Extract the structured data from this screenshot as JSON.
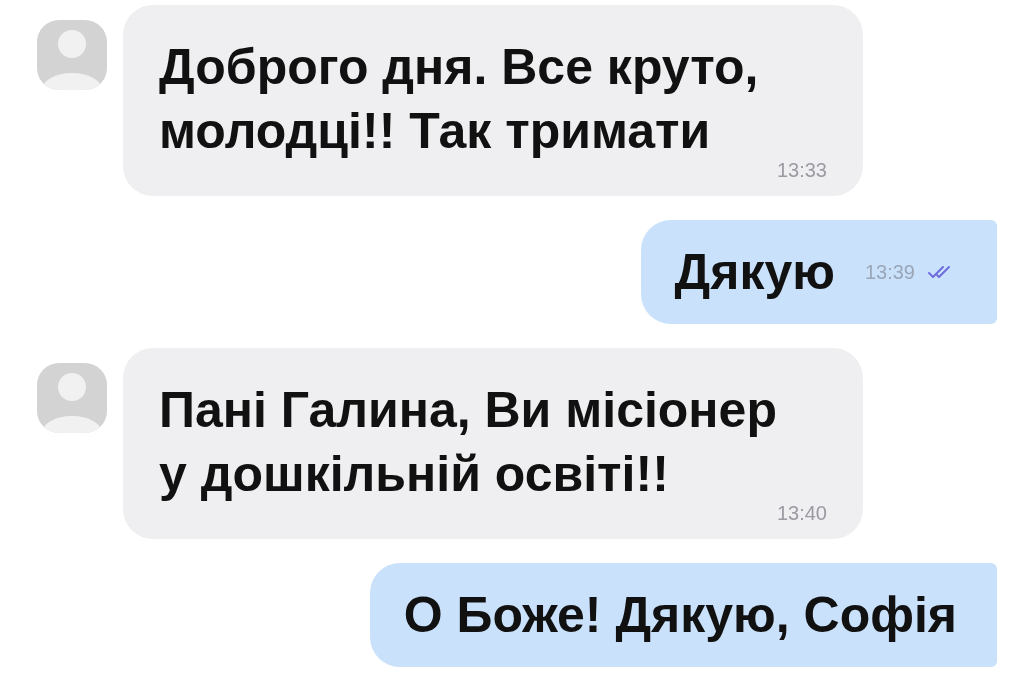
{
  "messages": [
    {
      "kind": "incoming",
      "text": "Доброго дня. Все круто, молодці!! Так тримати",
      "time": "13:33"
    },
    {
      "kind": "outgoing",
      "text": "Дякую",
      "time": "13:39",
      "read": true
    },
    {
      "kind": "incoming",
      "text": "Пані Галина, Ви місіонер у дошкільній освіті!!",
      "time": "13:40"
    },
    {
      "kind": "outgoing",
      "text": "О Боже! Дякую, Софія"
    }
  ]
}
